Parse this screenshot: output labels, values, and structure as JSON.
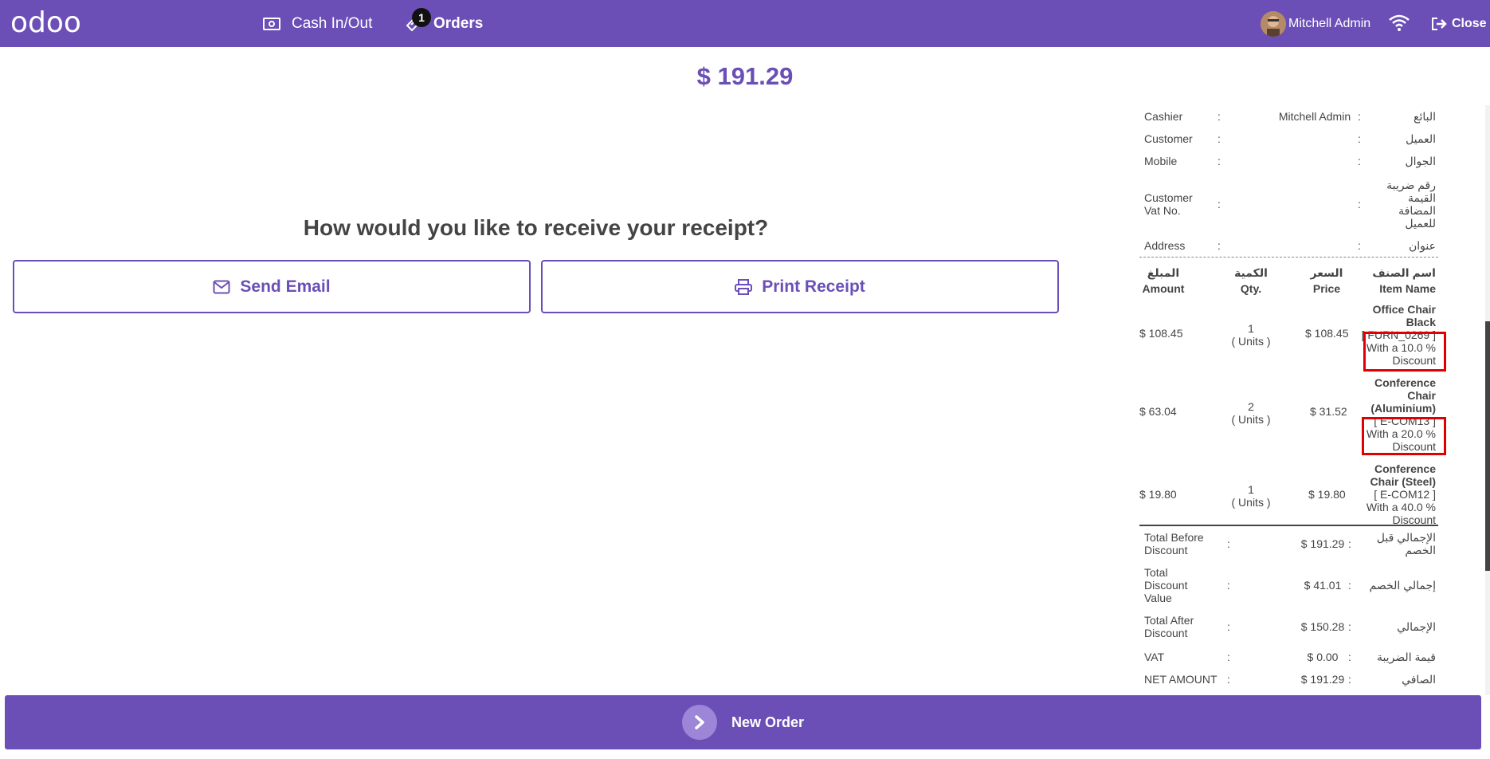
{
  "topbar": {
    "logo": "odoo",
    "cash_label": "Cash In/Out",
    "orders_label": "Orders",
    "orders_badge": "1",
    "user_name": "Mitchell Admin",
    "close_label": "Close"
  },
  "main": {
    "total_amount": "$ 191.29",
    "question": "How would you like to receive your receipt?",
    "send_email_label": "Send Email",
    "print_receipt_label": "Print Receipt"
  },
  "receipt": {
    "info": [
      {
        "en": "Cashier",
        "value": "Mitchell Admin",
        "ar": "البائع"
      },
      {
        "en": "Customer",
        "value": "",
        "ar": "العميل"
      },
      {
        "en": "Mobile",
        "value": "",
        "ar": "الجوال"
      },
      {
        "en": "Customer Vat No.",
        "value": "",
        "ar": "رقم ضريبة القيمة المضافة للعميل"
      },
      {
        "en": "Address",
        "value": "",
        "ar": "عنوان"
      }
    ],
    "colon": ":",
    "headers": {
      "amount_ar": "المبلغ",
      "amount_en": "Amount",
      "qty_ar": "الكمية",
      "qty_en": "Qty.",
      "price_ar": "السعر",
      "price_en": "Price",
      "item_ar": "اسم الصنف",
      "item_en": "Item Name"
    },
    "items": [
      {
        "amount": "$ 108.45",
        "qty": "1",
        "unit": "( Units )",
        "price": "$ 108.45",
        "name": "Office Chair Black",
        "code": "[ FURN_0269 ]",
        "discount": "With a 10.0 % Discount"
      },
      {
        "amount": "$ 63.04",
        "qty": "2",
        "unit": "( Units )",
        "price": "$ 31.52",
        "name": "Conference Chair (Aluminium)",
        "code": "[ E-COM13 ]",
        "discount": "With a 20.0 % Discount"
      },
      {
        "amount": "$ 19.80",
        "qty": "1",
        "unit": "( Units )",
        "price": "$ 19.80",
        "name": "Conference Chair (Steel)",
        "code": "[ E-COM12 ]",
        "discount": "With a 40.0 % Discount"
      }
    ],
    "totals": [
      {
        "en": "Total Before Discount",
        "value": "$ 191.29",
        "ar": "الإجمالي قبل الخصم"
      },
      {
        "en": "Total Discount Value",
        "value": "$ 41.01",
        "ar": "إجمالي الخصم"
      },
      {
        "en": "Total After Discount",
        "value": "$ 150.28",
        "ar": "الإجمالي"
      },
      {
        "en": "VAT",
        "value": "$ 0.00",
        "ar": "قيمة الضريبة"
      },
      {
        "en": "NET AMOUNT",
        "value": "$ 191.29",
        "ar": "الصافي"
      }
    ]
  },
  "footer": {
    "new_order_label": "New Order"
  },
  "colors": {
    "brand": "#6b4fb6",
    "highlight": "#e00000"
  }
}
